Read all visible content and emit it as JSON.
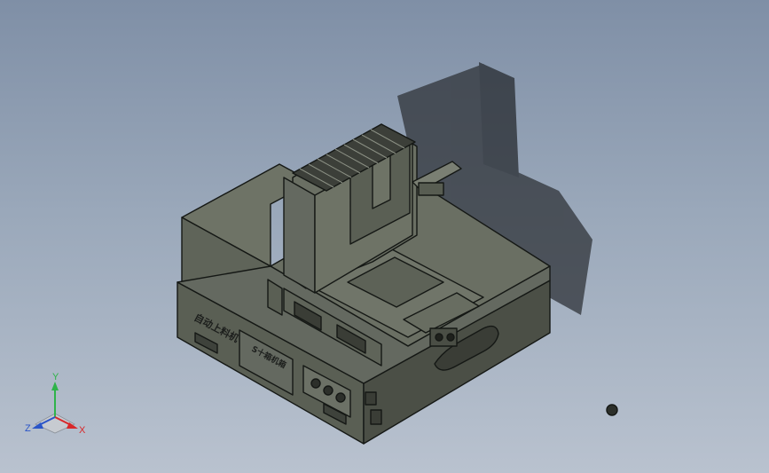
{
  "model": {
    "front_label": "自动上料机",
    "panel_label": "S十箱机箱"
  },
  "triad": {
    "x_label": "X",
    "y_label": "Y",
    "z_label": "Z",
    "x_color": "#d8282a",
    "y_color": "#2fb34a",
    "z_color": "#2a55c8"
  },
  "colors": {
    "body": "#5f6459",
    "body_dark": "#4b4f46",
    "body_light": "#6e7366",
    "edge": "#151815",
    "shadow": "#2f3338"
  }
}
